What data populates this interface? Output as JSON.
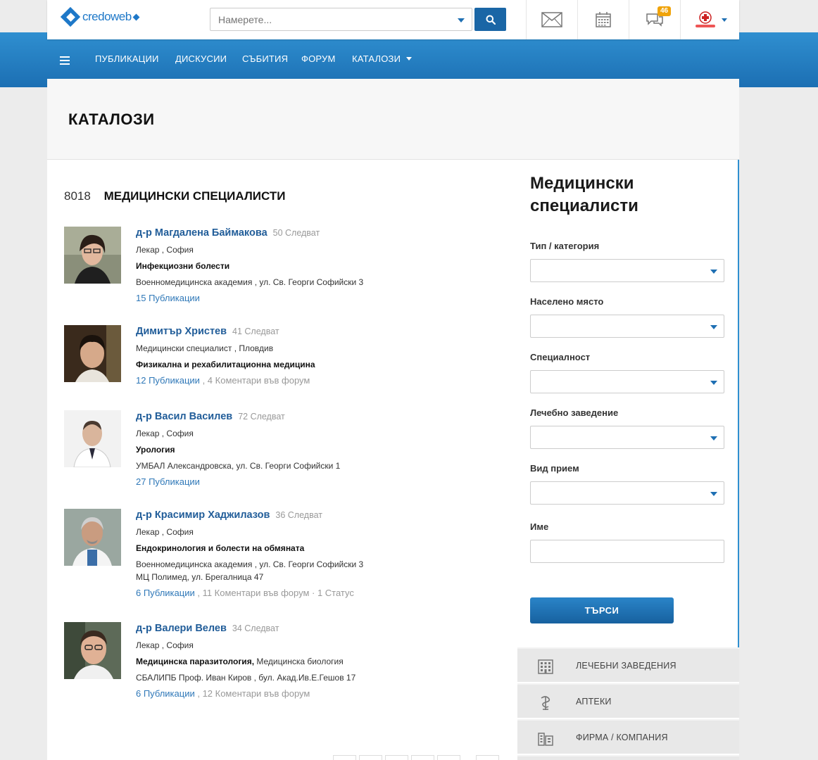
{
  "header": {
    "logo_text": "credoweb",
    "search_placeholder": "Намерете...",
    "messages_badge": "46"
  },
  "nav": {
    "items": [
      "ПУБЛИКАЦИИ",
      "ДИСКУСИИ",
      "СЪБИТИЯ",
      "ФОРУМ",
      "КАТАЛОЗИ"
    ]
  },
  "page": {
    "title": "КАТАЛОЗИ"
  },
  "list": {
    "count": "8018",
    "label": "МЕДИЦИНСКИ СПЕЦИАЛИСТИ",
    "items": [
      {
        "name": "д-р Магдалена Баймакова",
        "followers": "50 Следват",
        "role": "Лекар , София",
        "specialty": "Инфекциозни болести",
        "specialty_extra": "",
        "address": "Военномедицинска академия , ул. Св. Георги Софийски 3",
        "address2": "",
        "publications": "15 Публикации",
        "forum": "",
        "status": ""
      },
      {
        "name": "Димитър Христев",
        "followers": "41 Следват",
        "role": "Медицински специалист , Пловдив",
        "specialty": "Физикална и рехабилитационна медицина",
        "specialty_extra": "",
        "address": "",
        "address2": "",
        "publications": "12 Публикации",
        "forum": "4 Коментари във форум",
        "status": ""
      },
      {
        "name": "д-р Васил Василев",
        "followers": "72 Следват",
        "role": "Лекар , София",
        "specialty": "Урология",
        "specialty_extra": "",
        "address": "УМБАЛ Александровска, ул. Св. Георги Софийски 1",
        "address2": "",
        "publications": "27 Публикации",
        "forum": "",
        "status": ""
      },
      {
        "name": "д-р Красимир Хаджилазов",
        "followers": "36 Следват",
        "role": "Лекар , София",
        "specialty": "Ендокринология и болести на обмяната",
        "specialty_extra": "",
        "address": "Военномедицинска академия , ул. Св. Георги Софийски 3",
        "address2": "МЦ Полимед, ул. Брегалница 47",
        "publications": "6 Публикации",
        "forum": "11 Коментари във форум",
        "status": "1 Статус"
      },
      {
        "name": "д-р Валери Велев",
        "followers": "34 Следват",
        "role": "Лекар , София",
        "specialty": "Медицинска паразитология,",
        "specialty_extra": "Медицинска биология",
        "address": "СБАЛИПБ Проф. Иван Киров , бул. Акад.Ив.Е.Гешов 17",
        "address2": "",
        "publications": "6 Публикации",
        "forum": "12 Коментари във форум",
        "status": ""
      }
    ]
  },
  "sidebar": {
    "title_line1": "Медицински",
    "title_line2": "специалисти",
    "filters": {
      "type_label": "Тип / категория",
      "place_label": "Населено място",
      "specialty_label": "Специалност",
      "facility_label": "Лечебно заведение",
      "reception_label": "Вид прием",
      "name_label": "Име"
    },
    "search_button": "ТЪРСИ",
    "categories": [
      "ЛЕЧЕБНИ ЗАВЕДЕНИЯ",
      "АПТЕКИ",
      "ФИРМА / КОМПАНИЯ"
    ]
  },
  "colors": {
    "brand_blue": "#1e78c8",
    "link_blue": "#215d99",
    "badge_orange": "#f0a30a"
  }
}
